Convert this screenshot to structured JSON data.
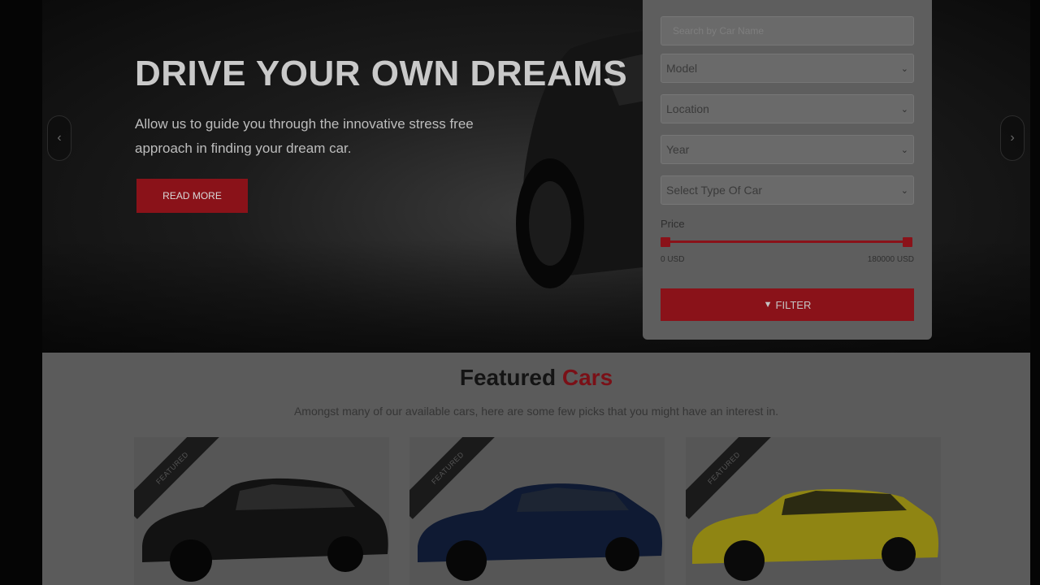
{
  "hero": {
    "title": "DRIVE YOUR OWN DREAMS",
    "subtitle": "Allow us to guide you through the innovative stress free approach in finding your dream car.",
    "read_more_label": "READ MORE",
    "prev_arrow": "‹",
    "next_arrow": "›"
  },
  "filter": {
    "search_placeholder": "Search by Car Name",
    "selects": [
      {
        "label": "Model"
      },
      {
        "label": "Location"
      },
      {
        "label": "Year"
      },
      {
        "label": "Select Type Of Car"
      }
    ],
    "price_label": "Price",
    "price_min": "0 USD",
    "price_max": "180000 USD",
    "filter_button_label": "FILTER",
    "filter_icon": "funnel-icon"
  },
  "featured": {
    "title_main": "Featured",
    "title_accent": "Cars",
    "subtitle": "Amongst many of our available cars, here are some few picks that you might have an interest in.",
    "cards": [
      {
        "badge": "Featured",
        "car_color": "#121212"
      },
      {
        "badge": "Featured",
        "car_color": "#0f1a33"
      },
      {
        "badge": "Featured",
        "car_color": "#8f8513"
      }
    ]
  },
  "colors": {
    "accent": "#8a1219",
    "overlay": "dimmed"
  }
}
